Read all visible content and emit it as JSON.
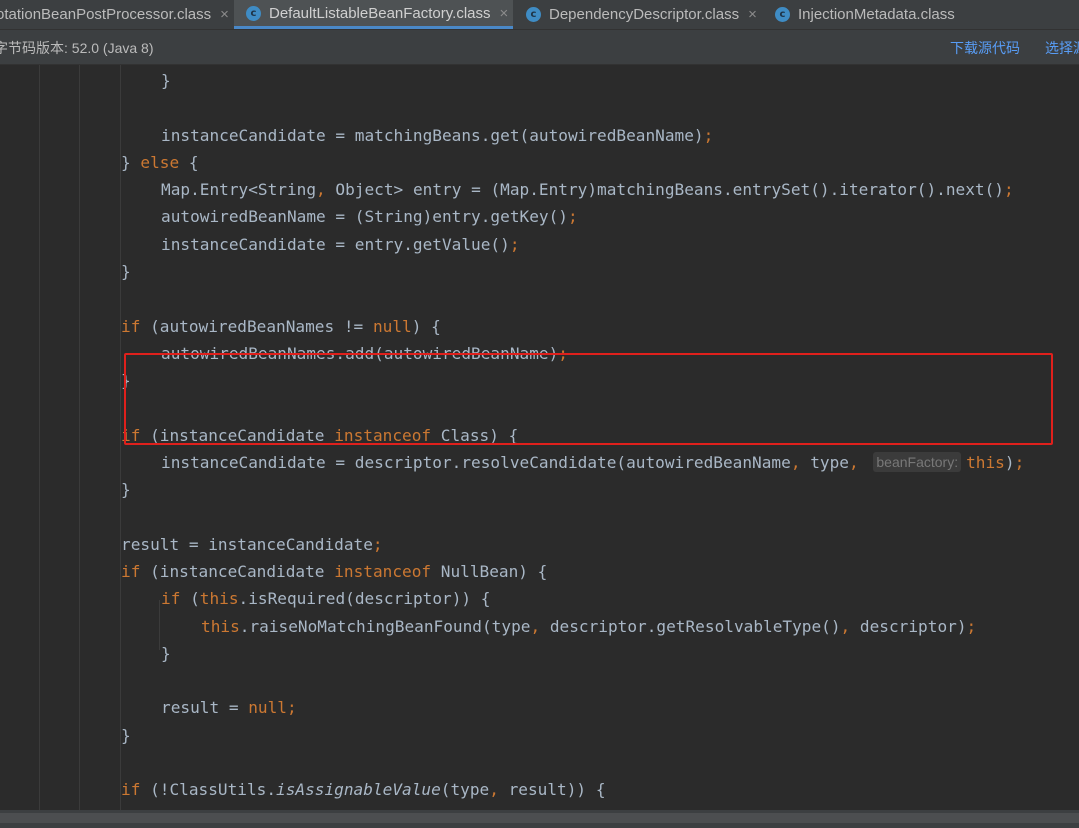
{
  "tabs": [
    {
      "label": "otationBeanPostProcessor.class",
      "active": false
    },
    {
      "label": "DefaultListableBeanFactory.class",
      "active": true
    },
    {
      "label": "DependencyDescriptor.class",
      "active": false
    },
    {
      "label": "InjectionMetadata.class",
      "active": false
    }
  ],
  "tab_close_glyph": "×",
  "tab_icon_letter": "c",
  "infobar": {
    "version_text": "字节码版本: 52.0 (Java 8)",
    "download_source": "下载源代码",
    "choose_source": "选择源"
  },
  "hint_label": "beanFactory:",
  "code": [
    [
      {
        "t": "}"
      }
    ],
    [],
    [
      {
        "t": "instanceCandidate = matchingBeans.get(autowiredBeanName)"
      },
      {
        "t": ";",
        "c": "kw"
      }
    ],
    [
      {
        "t": "} "
      },
      {
        "t": "else",
        "c": "kw"
      },
      {
        "t": " {"
      }
    ],
    [
      {
        "t": "Map.Entry<String"
      },
      {
        "t": ",",
        "c": "kw"
      },
      {
        "t": " Object> entry = (Map.Entry)matchingBeans.entrySet().iterator().next()"
      },
      {
        "t": ";",
        "c": "kw"
      }
    ],
    [
      {
        "t": "autowiredBeanName = (String)entry.getKey()"
      },
      {
        "t": ";",
        "c": "kw"
      }
    ],
    [
      {
        "t": "instanceCandidate = entry.getValue()"
      },
      {
        "t": ";",
        "c": "kw"
      }
    ],
    [
      {
        "t": "}"
      }
    ],
    [],
    [
      {
        "t": "if",
        "c": "kw"
      },
      {
        "t": " (autowiredBeanNames != "
      },
      {
        "t": "null",
        "c": "kw"
      },
      {
        "t": ") {"
      }
    ],
    [
      {
        "t": "autowiredBeanNames.add(autowiredBeanName)"
      },
      {
        "t": ";",
        "c": "kw"
      }
    ],
    [
      {
        "t": "}"
      }
    ],
    [],
    [
      {
        "t": "if",
        "c": "kw"
      },
      {
        "t": " (instanceCandidate "
      },
      {
        "t": "instanceof",
        "c": "kw"
      },
      {
        "t": " Class) {"
      }
    ],
    [
      {
        "t": "instanceCandidate = descriptor.resolveCandidate(autowiredBeanName"
      },
      {
        "t": ",",
        "c": "kw"
      },
      {
        "t": " type"
      },
      {
        "t": ",",
        "c": "kw"
      },
      {
        "t": " "
      },
      {
        "hint": true
      },
      {
        "t": "this",
        "c": "kw"
      },
      {
        "t": ")"
      },
      {
        "t": ";",
        "c": "kw"
      }
    ],
    [
      {
        "t": "}"
      }
    ],
    [],
    [
      {
        "t": "result = instanceCandidate"
      },
      {
        "t": ";",
        "c": "kw"
      }
    ],
    [
      {
        "t": "if",
        "c": "kw"
      },
      {
        "t": " (instanceCandidate "
      },
      {
        "t": "instanceof",
        "c": "kw"
      },
      {
        "t": " NullBean) {"
      }
    ],
    [
      {
        "t": "if",
        "c": "kw"
      },
      {
        "t": " ("
      },
      {
        "t": "this",
        "c": "kw"
      },
      {
        "t": ".isRequired(descriptor)) {"
      }
    ],
    [
      {
        "t": "this",
        "c": "kw"
      },
      {
        "t": ".raiseNoMatchingBeanFound(type"
      },
      {
        "t": ",",
        "c": "kw"
      },
      {
        "t": " descriptor.getResolvableType()"
      },
      {
        "t": ",",
        "c": "kw"
      },
      {
        "t": " descriptor)"
      },
      {
        "t": ";",
        "c": "kw"
      }
    ],
    [
      {
        "t": "}"
      }
    ],
    [],
    [
      {
        "t": "result = "
      },
      {
        "t": "null",
        "c": "kw"
      },
      {
        "t": ";",
        "c": "kw"
      }
    ],
    [
      {
        "t": "}"
      }
    ],
    [],
    [
      {
        "t": "if",
        "c": "kw"
      },
      {
        "t": " (!ClassUtils."
      },
      {
        "t": "isAssignableValue",
        "c": "it"
      },
      {
        "t": "(type"
      },
      {
        "t": ",",
        "c": "kw"
      },
      {
        "t": " result)) {"
      }
    ]
  ]
}
